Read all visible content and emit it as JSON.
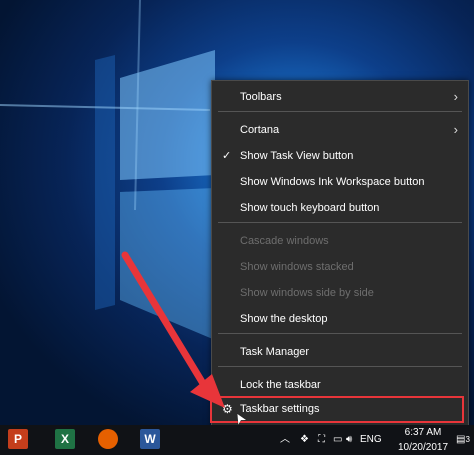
{
  "context_menu": {
    "items": [
      {
        "label": "Toolbars",
        "submenu": true,
        "disabled": false,
        "checked": false
      },
      {
        "label": "Cortana",
        "submenu": true,
        "disabled": false,
        "checked": false
      },
      {
        "label": "Show Task View button",
        "submenu": false,
        "disabled": false,
        "checked": true
      },
      {
        "label": "Show Windows Ink Workspace button",
        "submenu": false,
        "disabled": false,
        "checked": false
      },
      {
        "label": "Show touch keyboard button",
        "submenu": false,
        "disabled": false,
        "checked": false
      },
      {
        "label": "Cascade windows",
        "submenu": false,
        "disabled": true,
        "checked": false
      },
      {
        "label": "Show windows stacked",
        "submenu": false,
        "disabled": true,
        "checked": false
      },
      {
        "label": "Show windows side by side",
        "submenu": false,
        "disabled": true,
        "checked": false
      },
      {
        "label": "Show the desktop",
        "submenu": false,
        "disabled": false,
        "checked": false
      },
      {
        "label": "Task Manager",
        "submenu": false,
        "disabled": false,
        "checked": false
      },
      {
        "label": "Lock the taskbar",
        "submenu": false,
        "disabled": false,
        "checked": false
      },
      {
        "label": "Taskbar settings",
        "submenu": false,
        "disabled": false,
        "checked": false,
        "icon": "gear-icon"
      }
    ],
    "chevron": "›",
    "check": "✓"
  },
  "taskbar": {
    "apps": [
      {
        "name": "powerpoint-icon",
        "color": "#c43e1c",
        "letter": "P"
      },
      {
        "name": "excel-icon",
        "color": "#1f7244",
        "letter": "X"
      },
      {
        "name": "firefox-icon",
        "color": "#e66000",
        "letter": ""
      },
      {
        "name": "word-icon",
        "color": "#2b579a",
        "letter": "W"
      }
    ],
    "language": "ENG",
    "time": "6:37 AM",
    "date": "10/20/2017",
    "notifications": "3"
  },
  "colors": {
    "highlight": "#e8353a",
    "arrow": "#e8353a"
  }
}
